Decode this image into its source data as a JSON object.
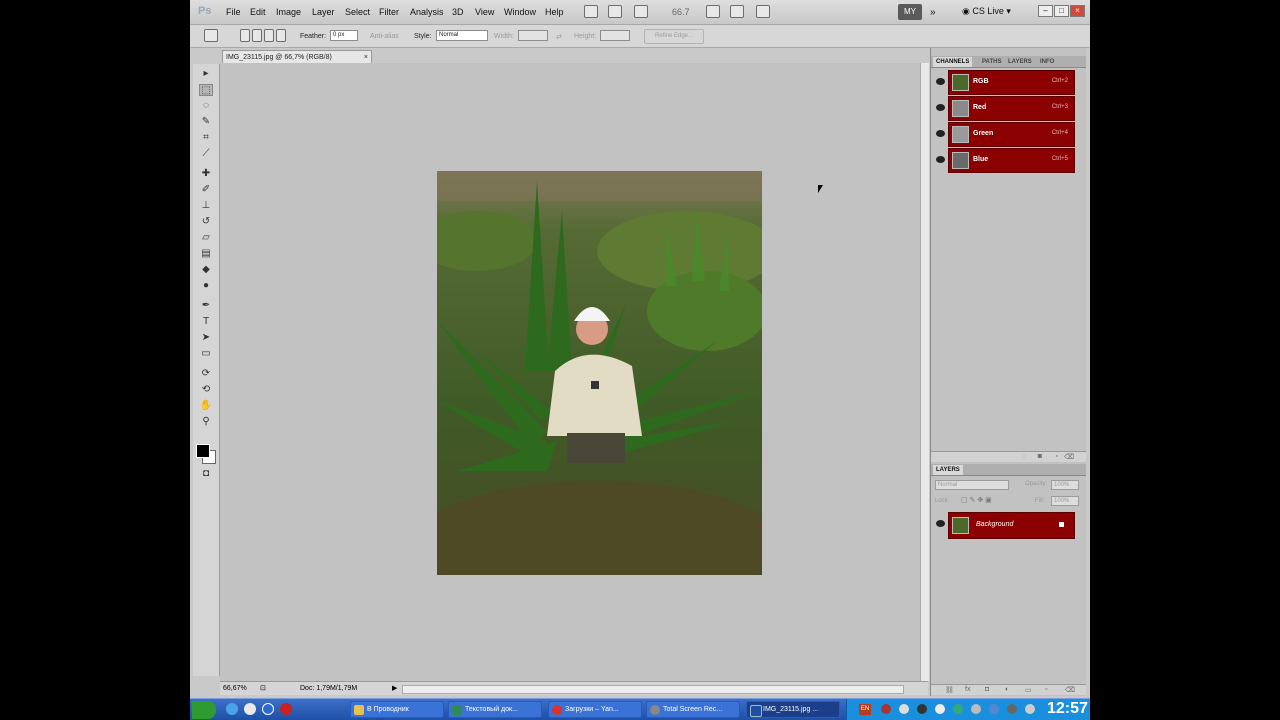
{
  "app": {
    "logo": "Ps",
    "menus": [
      "File",
      "Edit",
      "Image",
      "Layer",
      "Select",
      "Filter",
      "Analysis",
      "3D",
      "View",
      "Window",
      "Help"
    ],
    "zoom": "66.7",
    "workspace": "MY",
    "cs_live": "CS Live"
  },
  "options": {
    "feather_label": "Feather:",
    "feather_value": "0 px",
    "antialias": "Anti-alias",
    "style_label": "Style:",
    "style_value": "Normal",
    "width_label": "Width:",
    "height_label": "Height:",
    "refine_edge": "Refine Edge..."
  },
  "document": {
    "tab_title": "IMG_23115.jpg @ 66,7% (RGB/8)",
    "status_zoom": "66,67%",
    "doc_info": "Doc: 1,79M/1,79M"
  },
  "channels_panel": {
    "tabs": [
      "CHANNELS",
      "PATHS",
      "LAYERS",
      "INFO"
    ],
    "channels": [
      {
        "name": "RGB",
        "shortcut": "Ctrl+2"
      },
      {
        "name": "Red",
        "shortcut": "Ctrl+3"
      },
      {
        "name": "Green",
        "shortcut": "Ctrl+4"
      },
      {
        "name": "Blue",
        "shortcut": "Ctrl+5"
      }
    ]
  },
  "layers_panel": {
    "title": "LAYERS",
    "blend_mode": "Normal",
    "opacity_label": "Opacity:",
    "opacity_value": "100%",
    "lock_label": "Lock:",
    "fill_label": "Fill:",
    "fill_value": "100%",
    "layers": [
      {
        "name": "Background"
      }
    ]
  },
  "taskbar": {
    "items": [
      {
        "label": "В Проводник",
        "icon_color": "#e8c14a"
      },
      {
        "label": "Текстовый док...",
        "icon_color": "#2e8b57"
      },
      {
        "label": "Загрузки – Yan...",
        "icon_color": "#d9322c"
      },
      {
        "label": "Total Screen Rec...",
        "icon_color": "#888888"
      },
      {
        "label": "IMG_23115.jpg ...",
        "icon_color": "#1f4fa0"
      }
    ],
    "lang": "EN",
    "clock": "12:57"
  },
  "colors": {
    "channel_selected": "#8b0000",
    "taskbar": "#1c4ea6",
    "tray": "#1a8fdd"
  }
}
